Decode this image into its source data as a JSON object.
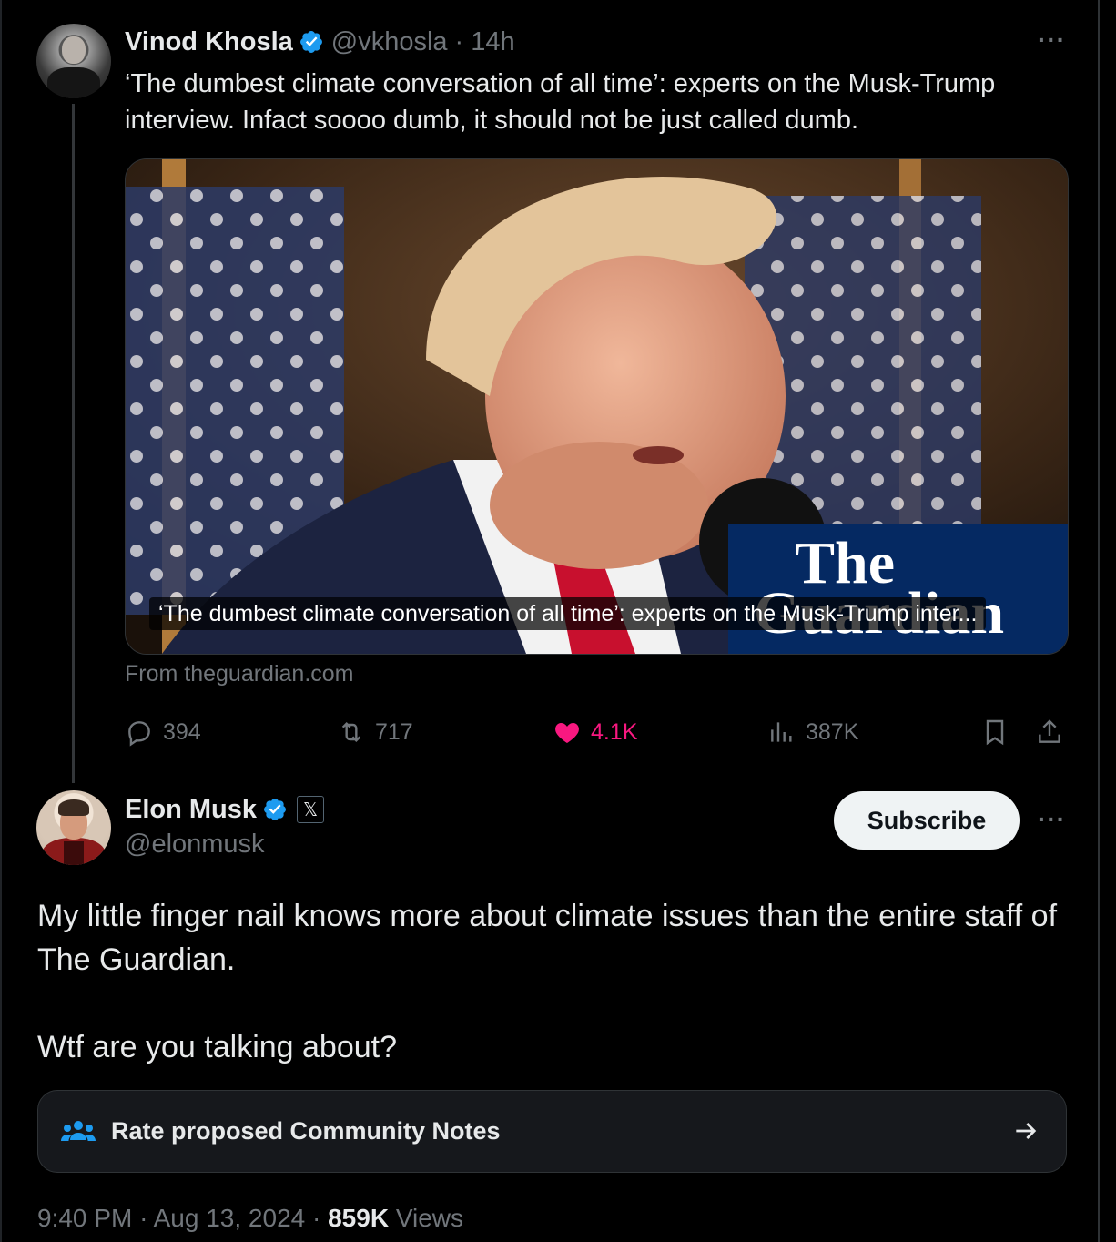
{
  "parent_tweet": {
    "author_name": "Vinod Khosla",
    "handle": "@vkhosla",
    "separator": "·",
    "time": "14h",
    "more": "···",
    "text": "‘The dumbest climate conversation of all time’: experts on the Musk-Trump interview. Infact soooo dumb, it should not be just called dumb.",
    "card": {
      "caption": "‘The dumbest climate conversation of all time’: experts on the Musk-Trump inter...",
      "logo_line1": "The",
      "logo_line2": "Guardian",
      "source": "From theguardian.com"
    },
    "actions": {
      "replies": "394",
      "reposts": "717",
      "likes": "4.1K",
      "views": "387K"
    }
  },
  "main_tweet": {
    "author_name": "Elon Musk",
    "handle": "@elonmusk",
    "x_badge": "𝕏",
    "subscribe_label": "Subscribe",
    "more": "···",
    "text_p1": "My little finger nail knows more about climate issues than the entire staff of The Guardian.",
    "text_p2": "Wtf are you talking about?",
    "community_notes_label": "Rate proposed Community Notes",
    "time": "9:40 PM",
    "date": "Aug 13, 2024",
    "sep": "·",
    "views_count": "859K",
    "views_label": "Views"
  },
  "colors": {
    "background": "#000000",
    "text": "#e7e9ea",
    "muted": "#71767b",
    "verified": "#1d9bf0",
    "like": "#f91880",
    "guardian_blue": "#052962"
  },
  "icons": [
    "verified-badge-icon",
    "more-icon",
    "reply-icon",
    "repost-icon",
    "like-icon",
    "views-icon",
    "bookmark-icon",
    "share-icon",
    "people-icon",
    "arrow-right-icon"
  ]
}
